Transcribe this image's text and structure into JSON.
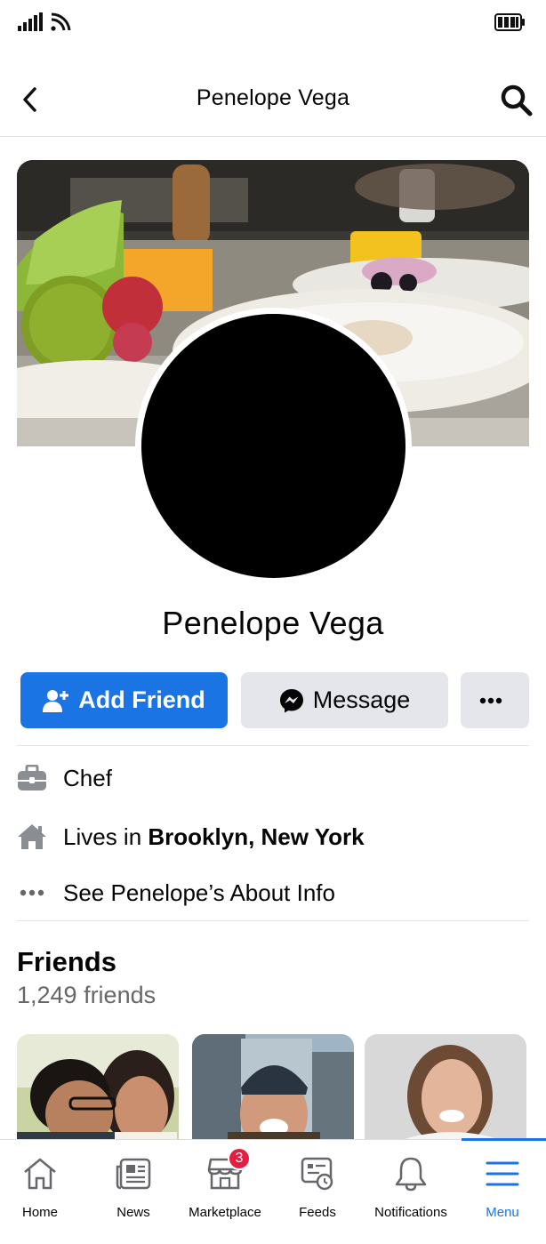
{
  "header": {
    "title": "Penelope Vega"
  },
  "profile": {
    "name": "Penelope Vega"
  },
  "actions": {
    "add_friend_label": "Add Friend",
    "message_label": "Message"
  },
  "intro": {
    "work": "Chef",
    "lives_prefix": "Lives in ",
    "lives_place": "Brooklyn, New York",
    "about_link": "See Penelope’s About Info"
  },
  "friends": {
    "title": "Friends",
    "count": "1,249 friends"
  },
  "bottom_nav": {
    "items": [
      {
        "label": "Home",
        "icon": "home-icon"
      },
      {
        "label": "News",
        "icon": "news-icon"
      },
      {
        "label": "Marketplace",
        "icon": "marketplace-icon",
        "badge": "3"
      },
      {
        "label": "Feeds",
        "icon": "feeds-icon"
      },
      {
        "label": "Notifications",
        "icon": "bell-icon"
      },
      {
        "label": "Menu",
        "icon": "menu-icon",
        "active": true
      }
    ]
  },
  "colors": {
    "accent": "#1b74e4",
    "button_gray": "#e4e6eb",
    "badge_red": "#e41e3f",
    "secondary_text": "#65676b"
  }
}
